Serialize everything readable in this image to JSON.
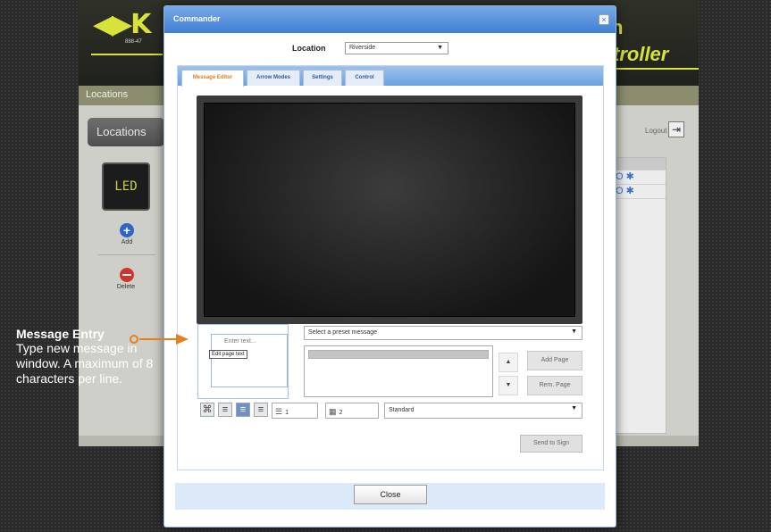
{
  "background_app": {
    "logo": "K",
    "logo_sub": "888-47",
    "title_line1": "n",
    "title_line2": "troller",
    "nav_label": "Locations",
    "locations_button": "Locations",
    "led_label": "LED",
    "add_label": "Add",
    "delete_label": "Delete",
    "logout_label": "Logout",
    "list_icons": [
      "O ✱",
      "O ✱"
    ]
  },
  "dialog": {
    "title": "Commander",
    "close_glyph": "×",
    "location_label": "Location",
    "location_value": "Riverside",
    "tabs": [
      {
        "label": "Message Editor",
        "active": true
      },
      {
        "label": "Arrow Modes",
        "active": false
      },
      {
        "label": "Settings",
        "active": false
      },
      {
        "label": "Control",
        "active": false
      }
    ],
    "entry_placeholder": "Enter text...",
    "entry_tooltip": "Edit page text",
    "preset_placeholder": "Select a preset message",
    "up_glyph": "▲",
    "down_glyph": "▼",
    "add_page": "Add Page",
    "remove_page": "Rem. Page",
    "line_spacing_value": "1",
    "char_spacing_value": "2",
    "font_value": "Standard",
    "send_button": "Send to Sign",
    "close_button": "Close"
  },
  "annotation": {
    "title": "Message Entry",
    "body": "Type new message in window. A maximum of 8 characters per line.",
    "accent": "#e2801d"
  }
}
